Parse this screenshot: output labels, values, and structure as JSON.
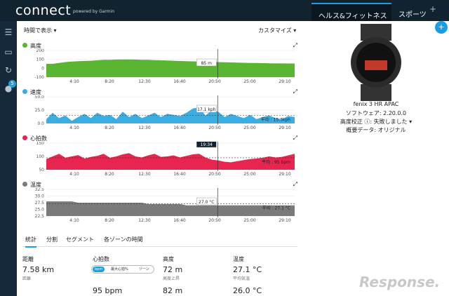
{
  "header": {
    "logo": "connect",
    "powered": "powered by Garmin",
    "tab_health": "ヘルス&フィットネス",
    "tab_sports": "スポーツ"
  },
  "sidebar": {
    "badge": "5"
  },
  "controls": {
    "time_select": "時間で表示 ▾",
    "customize": "カスタマイズ ▾"
  },
  "charts": [
    {
      "title": "高度",
      "color": "#5ab531",
      "yticks": [
        "200",
        "100",
        "0",
        "-100"
      ],
      "ymin": -100,
      "ymax": 200,
      "hover_label": "85 m",
      "values": [
        50,
        50,
        60,
        70,
        75,
        80,
        82,
        85,
        90,
        95,
        95,
        98,
        100,
        100,
        98,
        95,
        95,
        92,
        90,
        88,
        85,
        82,
        80,
        78,
        75,
        72,
        70,
        70,
        68,
        66,
        64,
        62,
        60,
        60,
        58,
        56,
        55,
        55,
        54,
        54
      ]
    },
    {
      "title": "速度",
      "color": "#3aaee3",
      "yticks": [
        "50.0",
        "25.0",
        "0.0"
      ],
      "ymin": 0,
      "ymax": 50,
      "hover_label": "17.1 kph",
      "avg_label": "平均 : 15.3kph",
      "avg": 15.3,
      "values": [
        8,
        20,
        10,
        15,
        5,
        12,
        18,
        10,
        20,
        14,
        16,
        8,
        22,
        12,
        18,
        10,
        15,
        20,
        12,
        18,
        16,
        14,
        20,
        28,
        30,
        15,
        25,
        22,
        12,
        18,
        14,
        10,
        16,
        8,
        12,
        15,
        10,
        8,
        14,
        12
      ]
    },
    {
      "title": "心拍数",
      "color": "#e8254e",
      "yticks": [
        "150",
        "100",
        "50"
      ],
      "ymin": 50,
      "ymax": 150,
      "hover_label": "19:34",
      "avg_label": "平均 : 95 bpm",
      "avg": 95,
      "values": [
        90,
        100,
        110,
        95,
        100,
        105,
        92,
        98,
        102,
        110,
        95,
        100,
        108,
        112,
        100,
        96,
        104,
        110,
        98,
        100,
        104,
        96,
        102,
        108,
        110,
        96,
        88,
        85,
        80,
        78,
        82,
        86,
        90,
        92,
        95,
        100,
        96,
        98,
        104,
        110
      ]
    },
    {
      "title": "温度",
      "color": "#7a7a7a",
      "yticks": [
        "32.5",
        "30.0",
        "27.5",
        "25.0",
        "22.5"
      ],
      "ymin": 22.5,
      "ymax": 32.5,
      "hover_label": "27.0 °C",
      "avg_label": "平均 : 27.1 °C",
      "avg": 27.1,
      "values": [
        28,
        28,
        28,
        28,
        28,
        27.5,
        27.5,
        27.5,
        27.5,
        27.5,
        27.5,
        27.5,
        27.5,
        27.5,
        27.5,
        27.5,
        27,
        27,
        27,
        27,
        27,
        27,
        26.5,
        26.5,
        26.5,
        26.5,
        26.5,
        26.5,
        26.5,
        26.5,
        26.5,
        26.5,
        26.5,
        26.5,
        26.5,
        26.5,
        26.5,
        26.5,
        26.5,
        26.5
      ]
    }
  ],
  "x_ticks": [
    "4:10",
    "8:20",
    "12:30",
    "16:40",
    "20:50",
    "25:00",
    "29:10"
  ],
  "device": {
    "name": "fenix 3 HR APAC",
    "software": "ソフトウェア: 2.20.0.0",
    "altitude": "高度校正 ⓘ: 失敗しました ▾",
    "summary": "概要データ: オリジナル"
  },
  "tabs": [
    "統計",
    "分割",
    "セグメント",
    "各ゾーンの時間"
  ],
  "stats": {
    "distance_label": "距離",
    "distance_value": "7.58 km",
    "distance_sub": "距離",
    "hr_label": "心拍数",
    "hr_toggle": [
      "bpm",
      "最大心拍%",
      "ゾーン"
    ],
    "hr_value": "95 bpm",
    "elev_label": "高度",
    "elev_value": "72 m",
    "elev_sub": "高度上昇",
    "elev_value2": "82 m",
    "temp_label": "温度",
    "temp_value": "27.1 °C",
    "temp_sub": "平均気温",
    "temp_value2": "26.0 °C"
  }
}
